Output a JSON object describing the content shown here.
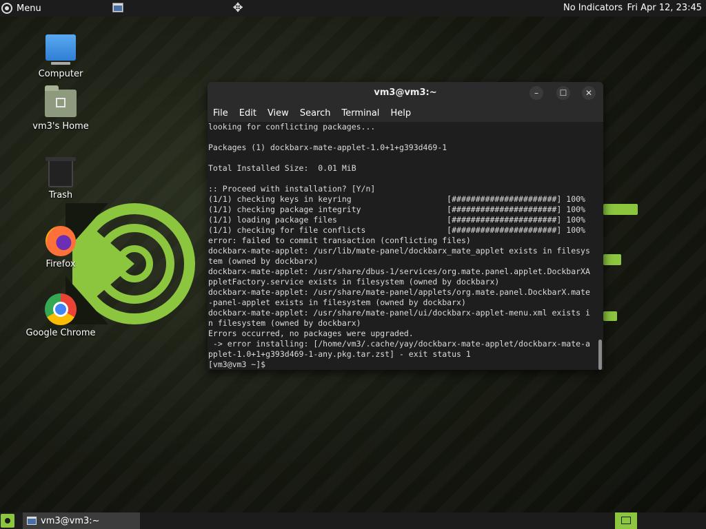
{
  "top_panel": {
    "menu_label": "Menu",
    "indicators": "No Indicators",
    "clock": "Fri Apr 12, 23:45"
  },
  "desktop": {
    "icons": [
      {
        "label": "Computer",
        "icon": "computer-icon"
      },
      {
        "label": "vm3's Home",
        "icon": "home-folder-icon"
      },
      {
        "label": "Trash",
        "icon": "trash-icon"
      },
      {
        "label": "Firefox",
        "icon": "firefox-icon"
      },
      {
        "label": "Google Chrome",
        "icon": "chrome-icon"
      }
    ]
  },
  "terminal": {
    "title": "vm3@vm3:~",
    "menu": [
      "File",
      "Edit",
      "View",
      "Search",
      "Terminal",
      "Help"
    ],
    "lines": [
      "looking for conflicting packages...",
      "",
      "Packages (1) dockbarx-mate-applet-1.0+1+g393d469-1",
      "",
      "Total Installed Size:  0.01 MiB",
      "",
      ":: Proceed with installation? [Y/n]",
      "(1/1) checking keys in keyring                    [######################] 100%",
      "(1/1) checking package integrity                  [######################] 100%",
      "(1/1) loading package files                       [######################] 100%",
      "(1/1) checking for file conflicts                 [######################] 100%",
      "error: failed to commit transaction (conflicting files)",
      "dockbarx-mate-applet: /usr/lib/mate-panel/dockbarx_mate_applet exists in filesys",
      "tem (owned by dockbarx)",
      "dockbarx-mate-applet: /usr/share/dbus-1/services/org.mate.panel.applet.DockbarXA",
      "ppletFactory.service exists in filesystem (owned by dockbarx)",
      "dockbarx-mate-applet: /usr/share/mate-panel/applets/org.mate.panel.DockbarX.mate",
      "-panel-applet exists in filesystem (owned by dockbarx)",
      "dockbarx-mate-applet: /usr/share/mate-panel/ui/dockbarx-applet-menu.xml exists i",
      "n filesystem (owned by dockbarx)",
      "Errors occurred, no packages were upgraded.",
      " -> error installing: [/home/vm3/.cache/yay/dockbarx-mate-applet/dockbarx-mate-a",
      "pplet-1.0+1+g393d469-1-any.pkg.tar.zst] - exit status 1",
      "[vm3@vm3 ~]$ "
    ]
  },
  "bottom_panel": {
    "task_label": "vm3@vm3:~"
  },
  "colors": {
    "accent": "#8cc63f",
    "panel": "#1c1c1c",
    "terminal_bg": "#1e1e1e"
  }
}
